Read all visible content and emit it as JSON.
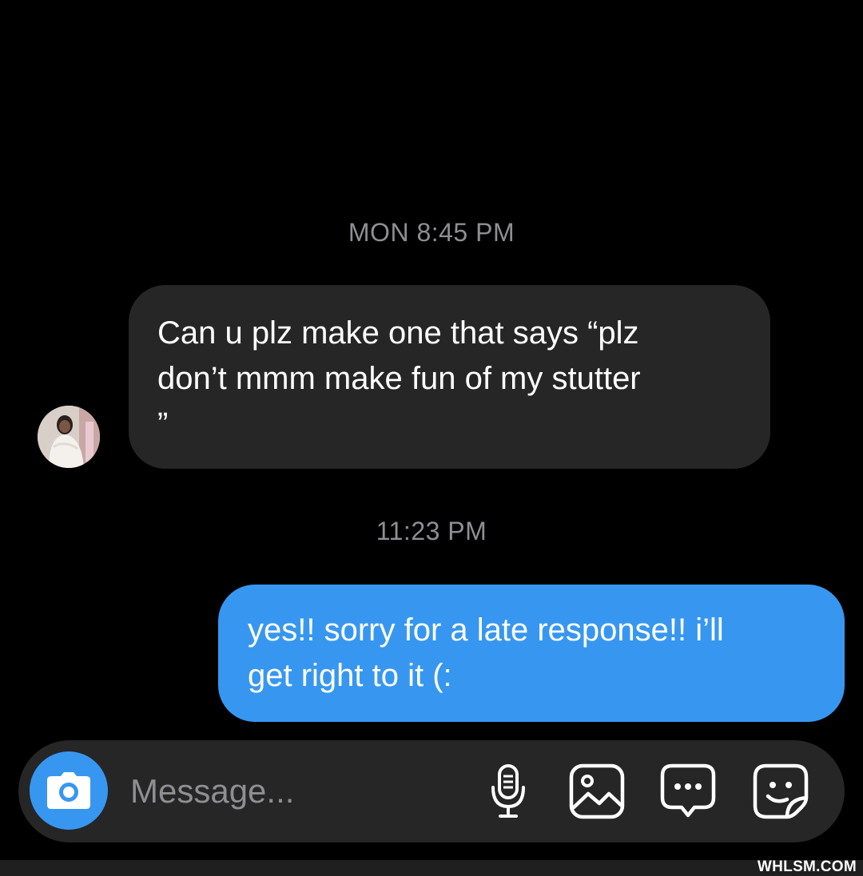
{
  "thread": {
    "timestamps": [
      "MON 8:45 PM",
      "11:23 PM"
    ],
    "messages": [
      {
        "direction": "incoming",
        "text": "Can u plz make one that says “plz\ndon’t mmm make fun of my stutter\n”"
      },
      {
        "direction": "outgoing",
        "text": "yes!! sorry for a late response!! i’ll\nget right to it (:"
      }
    ]
  },
  "composer": {
    "placeholder": "Message...",
    "value": "",
    "icons": [
      "camera-icon",
      "microphone-icon",
      "image-gallery-icon",
      "chat-bubble-icon",
      "sticker-icon"
    ]
  },
  "watermark": "WHLSM.COM",
  "colors": {
    "background": "#000000",
    "incoming_bubble": "#262626",
    "outgoing_bubble": "#3797f0",
    "timestamp": "#8e8e93",
    "composer": "#262626"
  }
}
